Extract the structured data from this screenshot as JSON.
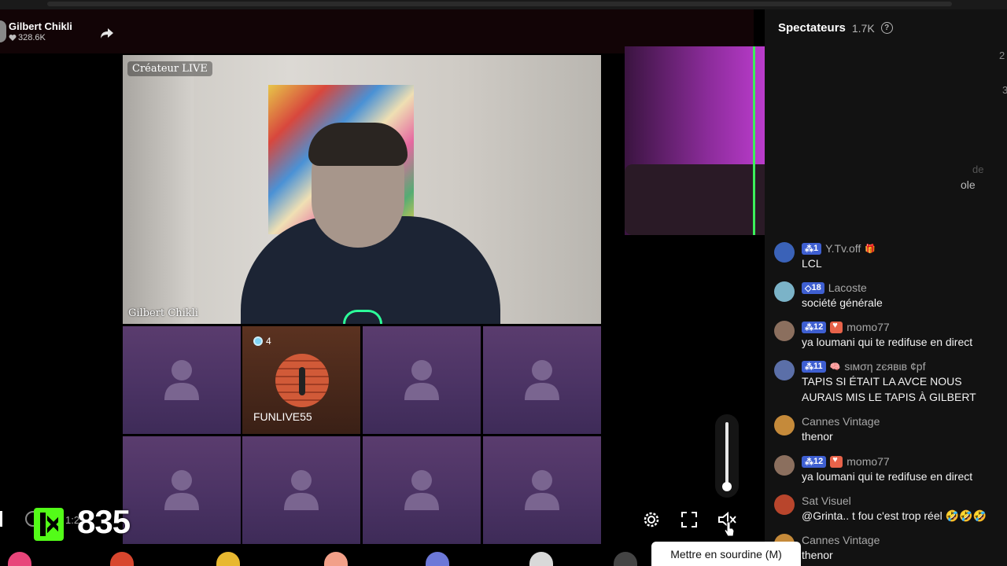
{
  "header": {
    "creator_name": "Gilbert Chikli",
    "likes": "328.6K"
  },
  "main_video": {
    "label_top": "Créateur LIVE",
    "label_bottom": "Gilbert Chikli"
  },
  "guest_tile": {
    "badge_level": "4",
    "name": "FUNLIVE55"
  },
  "overlay": {
    "kick_count": "835",
    "timer": "1:2"
  },
  "chat": {
    "title": "Spectateurs",
    "viewers": "1.7K",
    "faint_texts": [
      "2",
      "3",
      "de",
      "ole"
    ],
    "messages": [
      {
        "user": "Y.Tv.off",
        "level": "1",
        "text": "LCL",
        "avatar_color": "#3a62b8"
      },
      {
        "user": "Lacoste",
        "level": "18",
        "text": "société générale",
        "avatar_color": "#7bb3c8"
      },
      {
        "user": "momo77",
        "level": "12",
        "text": "ya loumani qui te redifuse en direct",
        "avatar_color": "#8b6f5e"
      },
      {
        "user": "sιмση zєявιв ¢pf",
        "level": "11",
        "text": "TAPIS SI ÉTAIT LA AVCE NOUS AURAIS MIS LE TAPIS À GILBERT",
        "avatar_color": "#5b6fa8"
      },
      {
        "user": "Cannes Vintage",
        "level": "",
        "text": "thenor",
        "avatar_color": "#c58a3a"
      },
      {
        "user": "momo77",
        "level": "12",
        "text": "ya loumani qui te redifuse en direct",
        "avatar_color": "#8b6f5e"
      },
      {
        "user": "Sat Visuel",
        "level": "",
        "text": "@Grinta.. t fou c'est trop réel 🤣🤣🤣",
        "avatar_color": "#b8452c"
      },
      {
        "user": "Cannes Vintage",
        "level": "",
        "text": "thenor",
        "avatar_color": "#c58a3a"
      }
    ]
  },
  "controls": {
    "tooltip": "Mettre en sourdine (M)"
  }
}
